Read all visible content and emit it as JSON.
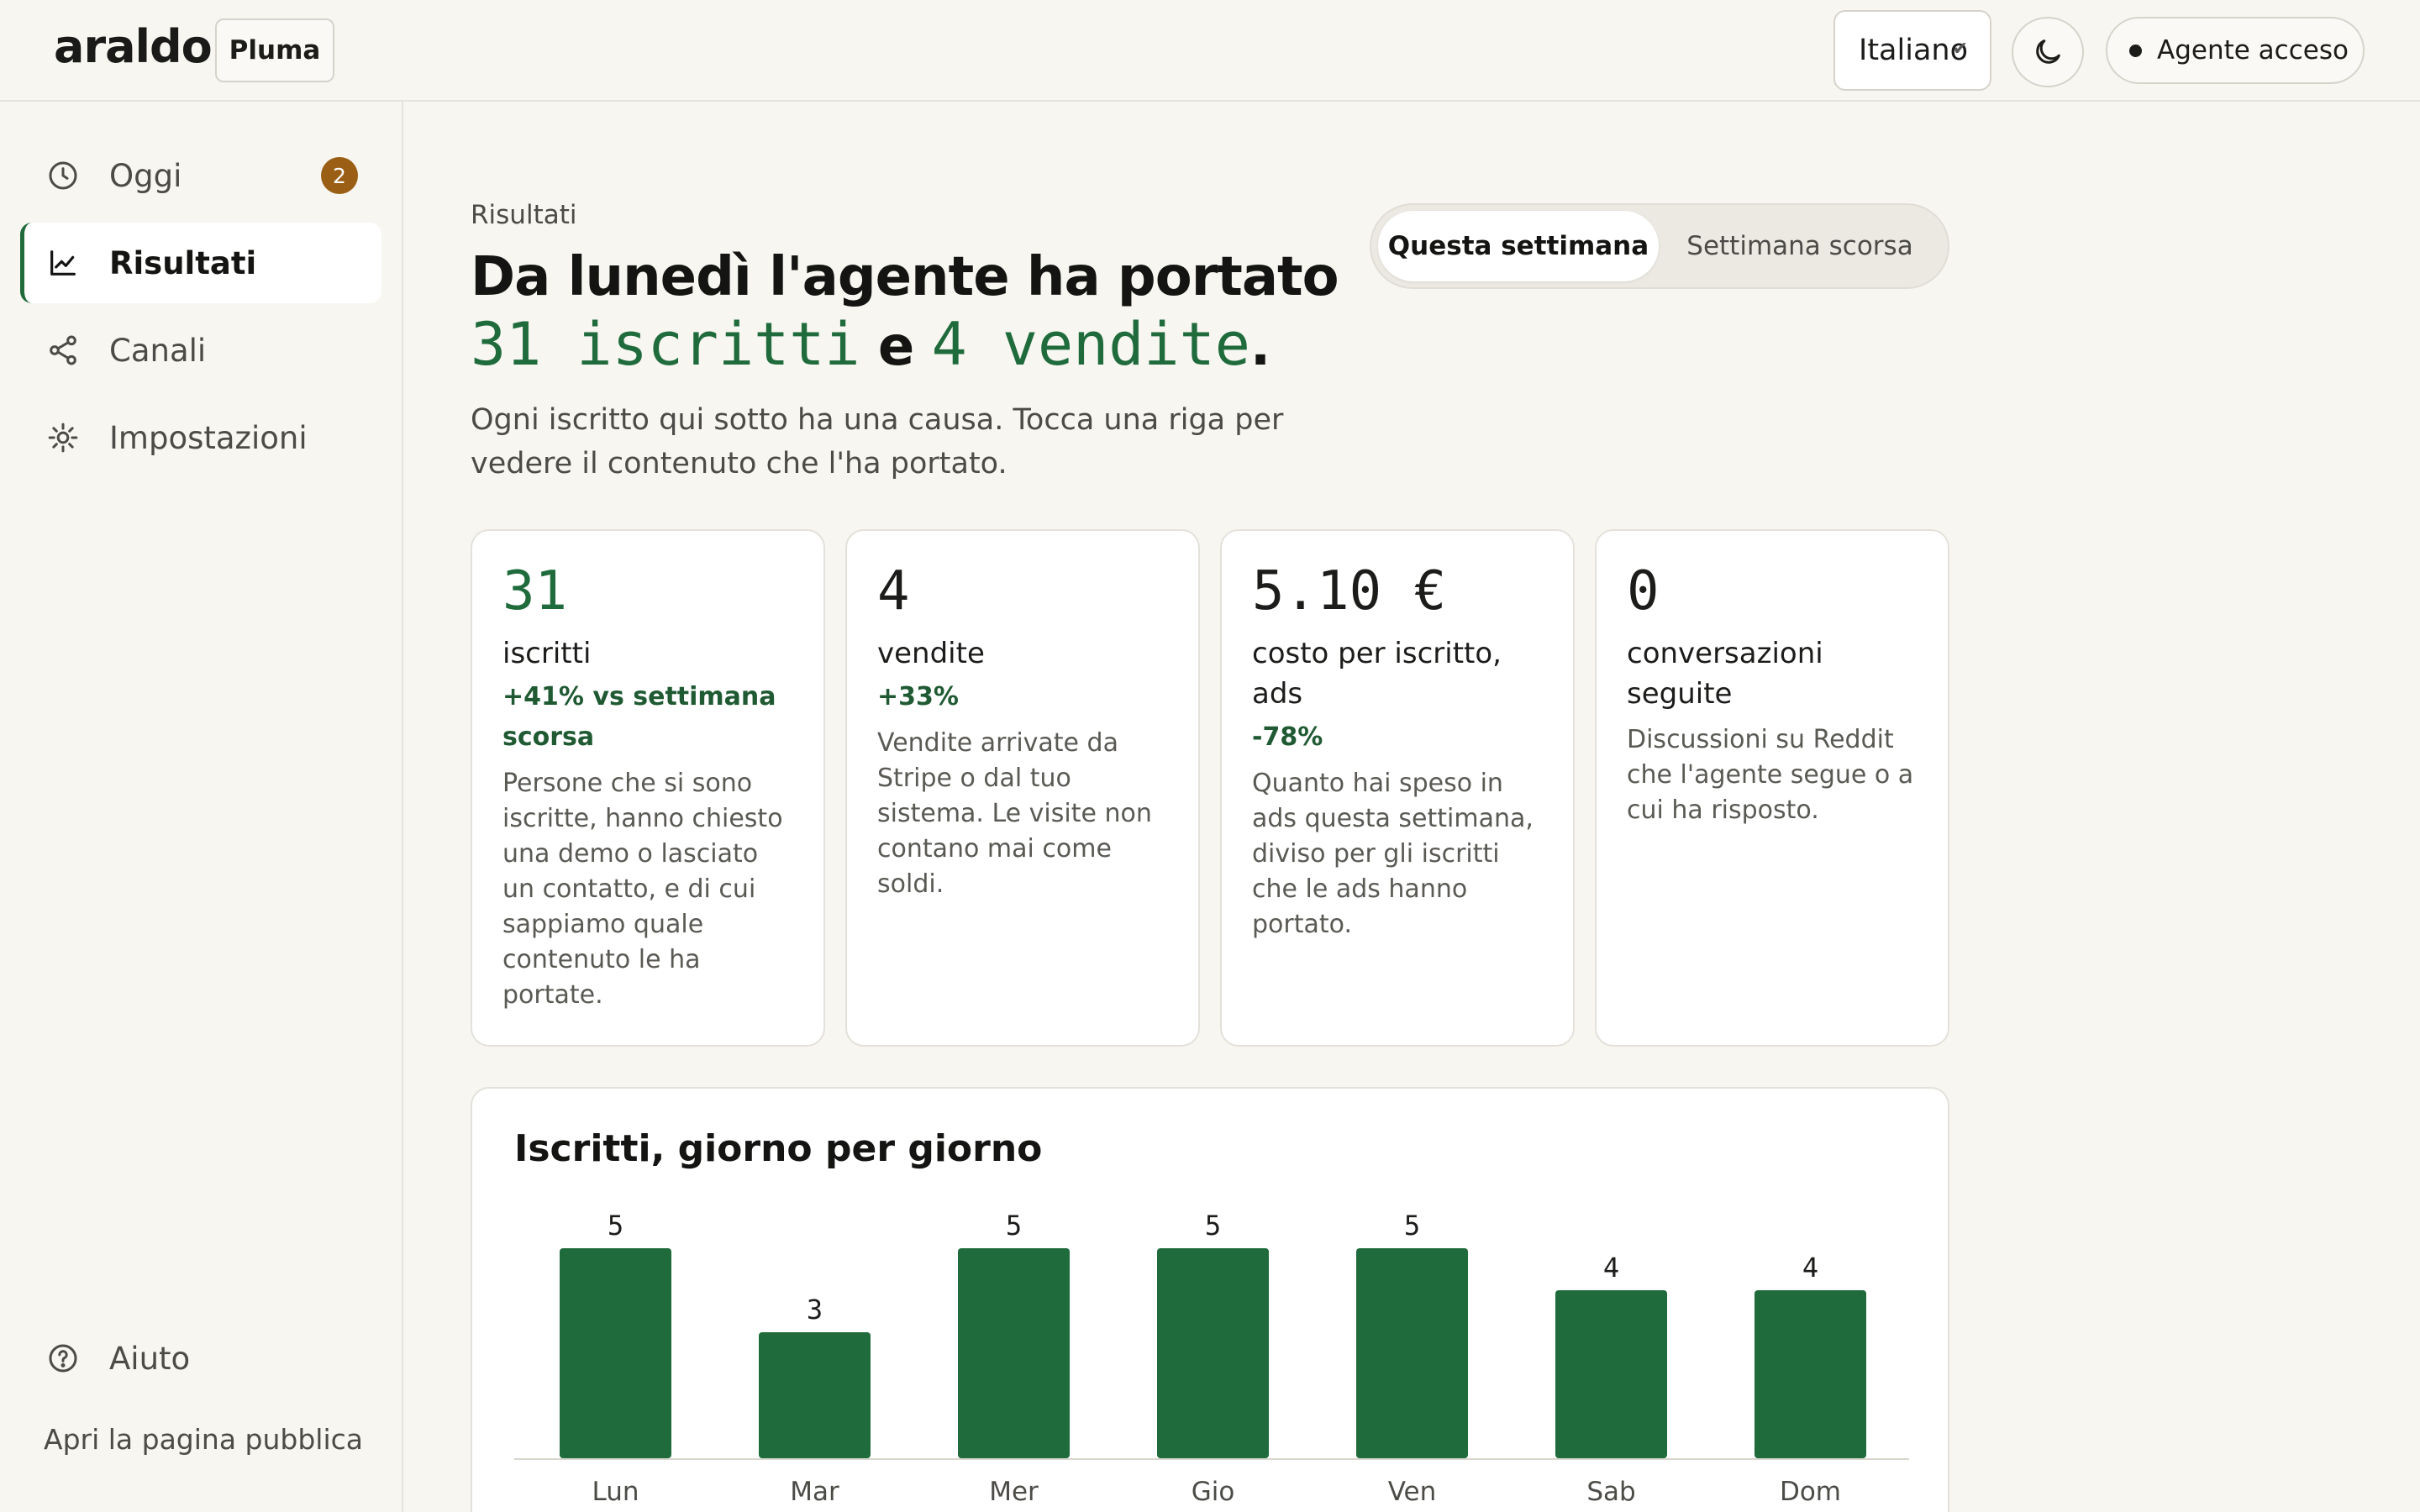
{
  "header": {
    "logo": "araldo",
    "workspace": "Pluma",
    "language": "Italiano",
    "agent_status": "Agente acceso"
  },
  "sidebar": {
    "items": [
      {
        "label": "Oggi",
        "icon": "clock-icon",
        "badge": "2"
      },
      {
        "label": "Risultati",
        "icon": "chart-line-icon",
        "active": true
      },
      {
        "label": "Canali",
        "icon": "share-icon"
      },
      {
        "label": "Impostazioni",
        "icon": "sun-gear-icon"
      }
    ],
    "help": {
      "label": "Aiuto",
      "icon": "help-circle-icon"
    },
    "public_link": "Apri la pagina pubblica"
  },
  "main": {
    "eyebrow": "Risultati",
    "headline_line1": "Da lunedì l'agente ha portato",
    "headline_subscribers": "31 iscritti",
    "headline_and": "e",
    "headline_sales": "4 vendite",
    "headline_end": ".",
    "intro": "Ogni iscritto qui sotto ha una causa. Tocca una riga per vedere il contenuto che l'ha portato.",
    "period_tabs": [
      "Questa settimana",
      "Settimana scorsa"
    ],
    "cards": [
      {
        "value": "31",
        "label": "iscritti",
        "delta": "+41% vs settimana scorsa",
        "desc": "Persone che si sono iscritte, hanno chiesto una demo o lasciato un contatto, e di cui sappiamo quale contenuto le ha portate."
      },
      {
        "value": "4",
        "label": "vendite",
        "delta": "+33%",
        "desc": "Vendite arrivate da Stripe o dal tuo sistema. Le visite non contano mai come soldi."
      },
      {
        "value": "5.10 €",
        "label": "costo per iscritto, ads",
        "delta": "-78%",
        "desc": "Quanto hai speso in ads questa settimana, diviso per gli iscritti che le ads hanno portato."
      },
      {
        "value": "0",
        "label": "conversazioni seguite",
        "delta": "",
        "desc": "Discussioni su Reddit che l'agente segue o a cui ha risposto."
      }
    ]
  },
  "chart_data": {
    "type": "bar",
    "title": "Iscritti, giorno per giorno",
    "categories": [
      "Lun",
      "Mar",
      "Mer",
      "Gio",
      "Ven",
      "Sab",
      "Dom"
    ],
    "values": [
      5,
      3,
      5,
      5,
      5,
      4,
      4
    ],
    "xlabel": "",
    "ylabel": "",
    "ylim": [
      0,
      5
    ],
    "grid": false,
    "bar_color": "#1f6b3c"
  },
  "colors": {
    "accent": "#1f6b3c",
    "badge": "#9a5f14",
    "background": "#f7f6f1"
  }
}
